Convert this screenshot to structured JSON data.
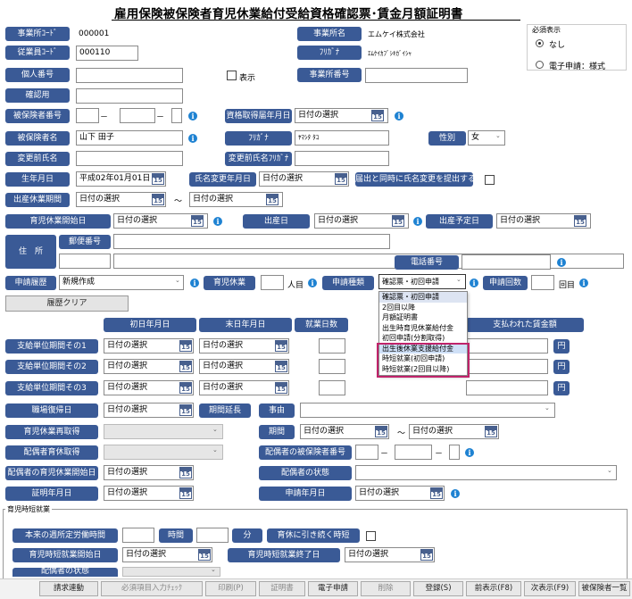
{
  "title": "雇用保険被保険者育児休業給付受給資格確認票･賃金月額証明書",
  "placeholder": "日付の選択",
  "cal_icon": "15",
  "info_mark": "i",
  "tilde": "～",
  "hyphen": "－",
  "caret": "⌄",
  "office_code": {
    "label": "事業所ｺｰﾄﾞ",
    "value": "000001"
  },
  "office_name": {
    "label": "事業所名",
    "value": "エムケイ株式会社"
  },
  "employee_code": {
    "label": "従業員ｺｰﾄﾞ",
    "value": "000110"
  },
  "office_kana": {
    "label": "ﾌﾘｶﾞﾅ",
    "value": "ｴﾑｹｲｶﾌﾞｼｷｶﾞｲｼｬ"
  },
  "personal_number": {
    "label": "個人番号",
    "show_label": "表示"
  },
  "office_number": {
    "label": "事業所番号"
  },
  "confirm": {
    "label": "確認用"
  },
  "insured_number": {
    "label": "被保険者番号"
  },
  "acquire_date": {
    "label": "資格取得届年月日"
  },
  "insured_name": {
    "label": "被保険者名",
    "value": "山下 田子"
  },
  "name_kana": {
    "label": "ﾌﾘｶﾞﾅ",
    "value": "ﾔﾏｼﾀ ﾀｺ"
  },
  "gender": {
    "label": "性別",
    "value": "女"
  },
  "former_name": {
    "label": "変更前氏名"
  },
  "former_kana": {
    "label": "変更前氏名ﾌﾘｶﾞﾅ"
  },
  "birth": {
    "label": "生年月日",
    "value": "平成02年01月01日"
  },
  "name_change_date": {
    "label": "氏名変更年月日"
  },
  "submit_name_change": {
    "label": "届出と同時に氏名変更を提出する"
  },
  "maternity_period": {
    "label": "出産休業期間"
  },
  "childcare_start": {
    "label": "育児休業開始日"
  },
  "birth_date": {
    "label": "出産日"
  },
  "due_date": {
    "label": "出産予定日"
  },
  "address": {
    "label": "住　所",
    "postal_label": "郵便番号"
  },
  "phone": {
    "label": "電話番号"
  },
  "history": {
    "label": "申請履歴",
    "value": "新規作成"
  },
  "childcare_leave": {
    "label": "育児休業",
    "unit": "人目"
  },
  "app_type": {
    "label": "申請種類",
    "value": "確認票・初回申請"
  },
  "app_count": {
    "label": "申請回数",
    "unit": "回目"
  },
  "history_clear": "履歴クリア",
  "dropdown_options": [
    "確認票・初回申請",
    "2回目以降",
    "月額証明書",
    "出生時育児休業給付金",
    "初回申請(分割取得)",
    "出生後休業支援給付金",
    "時短就業(初回申請)",
    "時短就業(2回目以降)"
  ],
  "table": {
    "headers": [
      "初日年月日",
      "末日年月日",
      "就業日数",
      "支払われた賃金額"
    ],
    "rows": [
      "支給単位期間その1",
      "支給単位期間その2",
      "支給単位期間その3"
    ],
    "yen": "円"
  },
  "return_date": {
    "label": "職場復帰日"
  },
  "extension": {
    "label": "期間延長"
  },
  "reason": {
    "label": "事由"
  },
  "reacquire": {
    "label": "育児休業再取得"
  },
  "period": {
    "label": "期間"
  },
  "spouse_leave": {
    "label": "配偶者育休取得"
  },
  "spouse_insured": {
    "label": "配偶者の被保険者番号"
  },
  "spouse_start": {
    "label": "配偶者の育児休業開始日"
  },
  "spouse_status": {
    "label": "配偶者の状態"
  },
  "cert_date": {
    "label": "証明年月日"
  },
  "apply_date": {
    "label": "申請年月日"
  },
  "short_work": {
    "group_label": "育児時短就業",
    "weekly_hours_label": "本来の週所定労働時間",
    "hours_unit": "時間",
    "minutes_unit": "分",
    "continue_label": "育休に引き続く時短",
    "start_label": "育児時短就業開始日",
    "end_label": "育児時短就業終了日",
    "spouse_status_label": "配偶者の状態"
  },
  "required": {
    "title": "必須表示",
    "opt_none": "なし",
    "opt_electronic": "電子申請：様式"
  },
  "buttons": [
    "請求連動",
    "必須項目入力ﾁｪｯｸ",
    "印刷(P)",
    "証明書",
    "電子申請",
    "削除",
    "登録(S)",
    "前表示(F8)",
    "次表示(F9)",
    "被保険者一覧"
  ]
}
